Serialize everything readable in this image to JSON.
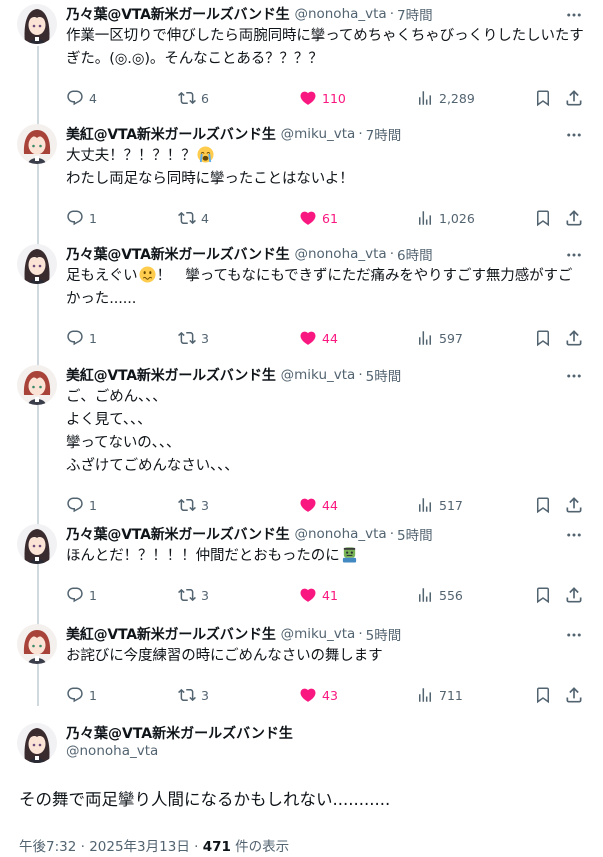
{
  "theme": {
    "accent_like": "#f91880",
    "muted": "#536471",
    "thread_line": "#cfd9de"
  },
  "replies": [
    {
      "author": "乃々葉@VTA新米ガールズバンド生",
      "handle": "@nonoha_vta",
      "time": "7時間",
      "avatar": "nonoha-avatar",
      "text": "作業一区切りで伸びしたら両腕同時に攣ってめちゃくちゃびっくりしたしいたすぎた。(◎.◎)。そんなことある？？？？",
      "reply_count": "4",
      "retweet_count": "6",
      "like_count": "110",
      "view_count": "2,289"
    },
    {
      "author": "美紅@VTA新米ガールズバンド生",
      "handle": "@miku_vta",
      "time": "7時間",
      "avatar": "miku-avatar",
      "text_before_emoji": "大丈夫！？！？！？",
      "emoji": "loudly-crying-face",
      "text_after_emoji": "\nわたし両足なら同時に攣ったことはないよ！",
      "reply_count": "1",
      "retweet_count": "4",
      "like_count": "61",
      "view_count": "1,026"
    },
    {
      "author": "乃々葉@VTA新米ガールズバンド生",
      "handle": "@nonoha_vta",
      "time": "6時間",
      "avatar": "nonoha-avatar",
      "text_before_emoji": "足もえぐい",
      "emoji": "wavy-mouth-face",
      "text_after_emoji": "！　攣ってもなにもできずにただ痛みをやりすごす無力感がすごかった......",
      "reply_count": "1",
      "retweet_count": "3",
      "like_count": "44",
      "view_count": "597"
    },
    {
      "author": "美紅@VTA新米ガールズバンド生",
      "handle": "@miku_vta",
      "time": "5時間",
      "avatar": "miku-avatar",
      "text": "ご、ごめん、、、\nよく見て、、、\n攣ってないの、、、\nふざけてごめんなさい、、、",
      "reply_count": "1",
      "retweet_count": "3",
      "like_count": "44",
      "view_count": "517"
    },
    {
      "author": "乃々葉@VTA新米ガールズバンド生",
      "handle": "@nonoha_vta",
      "time": "5時間",
      "avatar": "nonoha-avatar",
      "text_before_emoji": "ほんとだ！？！！！仲間だとおもったのに",
      "emoji": "zombie",
      "text_after_emoji": "",
      "reply_count": "1",
      "retweet_count": "3",
      "like_count": "41",
      "view_count": "556"
    },
    {
      "author": "美紅@VTA新米ガールズバンド生",
      "handle": "@miku_vta",
      "time": "5時間",
      "avatar": "miku-avatar",
      "text": "お詫びに今度練習の時にごめんなさいの舞します",
      "reply_count": "1",
      "retweet_count": "3",
      "like_count": "43",
      "view_count": "711"
    }
  ],
  "main_post": {
    "author": "乃々葉@VTA新米ガールズバンド生",
    "handle": "@nonoha_vta",
    "text": "その舞で両足攣り人間になるかもしれない...........",
    "timestamp": "午後7:32 · 2025年3月13日 · ",
    "views": "471",
    "views_suffix": " 件の表示"
  }
}
